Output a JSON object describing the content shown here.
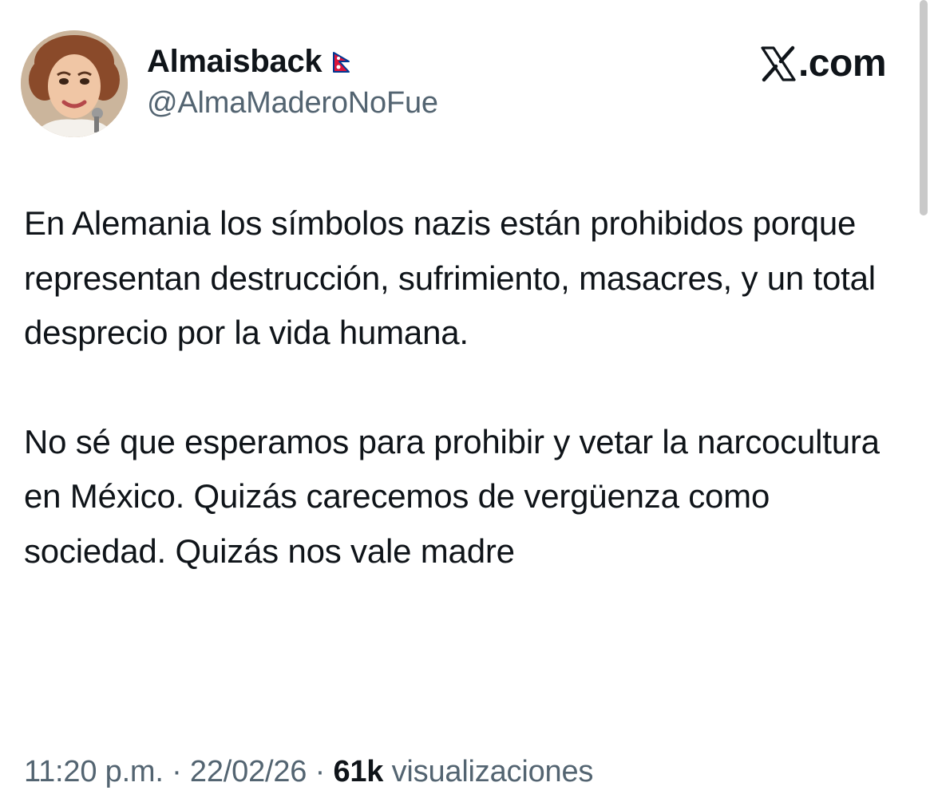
{
  "header": {
    "display_name": "Almaisback",
    "handle": "@AlmaMaderoNoFue",
    "source": ".com",
    "avatar_icon": "profile-avatar",
    "flag_icon": "nepal-flag-icon",
    "logo_icon": "x-logo-icon"
  },
  "tweet": {
    "paragraphs": [
      "En Alemania los símbolos nazis están prohibidos porque representan destrucción, sufrimiento, masacres, y un total desprecio por la vida humana.",
      "No sé que esperamos para prohibir y vetar la narcocultura en México. Quizás carecemos de vergüenza como sociedad. Quizás nos vale madre"
    ]
  },
  "meta": {
    "time": "11:20 p.m.",
    "separator": "·",
    "date": "22/02/26",
    "views_count": "61k",
    "views_label": "visualizaciones"
  },
  "colors": {
    "text_primary": "#0f1419",
    "text_secondary": "#536471",
    "flag_red": "#dc143c",
    "flag_blue": "#003893"
  }
}
